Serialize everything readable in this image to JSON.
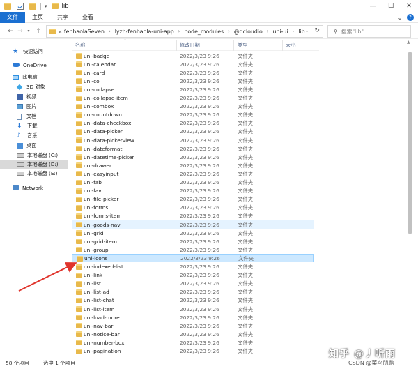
{
  "window": {
    "title": "lib",
    "controls": {
      "minimize": "—",
      "maximize": "☐",
      "close": "✕"
    }
  },
  "ribbon": {
    "tabs": [
      "文件",
      "主页",
      "共享",
      "查看"
    ],
    "expand_glyph": "⌄",
    "help_glyph": "?"
  },
  "nav": {
    "back": "←",
    "forward": "→",
    "recent": "▾",
    "up": "↑",
    "prefix": "«",
    "breadcrumb": [
      "fenhaolaSeven",
      "lyzh-fenhaola-uni-app",
      "node_modules",
      "@dcloudio",
      "uni-ui",
      "lib"
    ],
    "separator": "›",
    "dropdown": "⌄",
    "refresh": "↻",
    "search_glyph": "⚲",
    "search_placeholder": "搜索\"lib\""
  },
  "sidebar": {
    "items": [
      {
        "label": "快速访问",
        "icon": "star-icon"
      },
      {
        "label": "OneDrive",
        "icon": "cloud-icon"
      },
      {
        "label": "此电脑",
        "icon": "computer-icon"
      },
      {
        "label": "3D 对象",
        "icon": "cube-icon"
      },
      {
        "label": "视频",
        "icon": "video-icon"
      },
      {
        "label": "图片",
        "icon": "picture-icon"
      },
      {
        "label": "文档",
        "icon": "document-icon"
      },
      {
        "label": "下载",
        "icon": "download-icon"
      },
      {
        "label": "音乐",
        "icon": "music-icon"
      },
      {
        "label": "桌面",
        "icon": "desktop-icon"
      },
      {
        "label": "本地磁盘 (C:)",
        "icon": "drive-icon"
      },
      {
        "label": "本地磁盘 (D:)",
        "icon": "drive-icon"
      },
      {
        "label": "本地磁盘 (E:)",
        "icon": "drive-icon"
      },
      {
        "label": "Network",
        "icon": "network-icon"
      }
    ],
    "selected_index": 11
  },
  "columns": {
    "name": "名称",
    "date": "修改日期",
    "type": "类型",
    "size": "大小",
    "sort_glyph": "^"
  },
  "files": {
    "date": "2022/3/23 9:26",
    "type": "文件夹",
    "names": [
      "uni-badge",
      "uni-calendar",
      "uni-card",
      "uni-col",
      "uni-collapse",
      "uni-collapse-item",
      "uni-combox",
      "uni-countdown",
      "uni-data-checkbox",
      "uni-data-picker",
      "uni-data-pickerview",
      "uni-dateformat",
      "uni-datetime-picker",
      "uni-drawer",
      "uni-easyinput",
      "uni-fab",
      "uni-fav",
      "uni-file-picker",
      "uni-forms",
      "uni-forms-item",
      "uni-goods-nav",
      "uni-grid",
      "uni-grid-item",
      "uni-group",
      "uni-icons",
      "uni-indexed-list",
      "uni-link",
      "uni-list",
      "uni-list-ad",
      "uni-list-chat",
      "uni-list-item",
      "uni-load-more",
      "uni-nav-bar",
      "uni-notice-bar",
      "uni-number-box",
      "uni-pagination"
    ],
    "hover_index": 20,
    "selected_index": 24
  },
  "status": {
    "count": "58 个项目",
    "selected": "选中 1 个项目"
  },
  "watermark": {
    "site": "知乎 @丿听雨",
    "csdn": "CSDN @菜鸟朋鹏"
  },
  "annotation": {
    "arrow_color": "#e0332b"
  }
}
